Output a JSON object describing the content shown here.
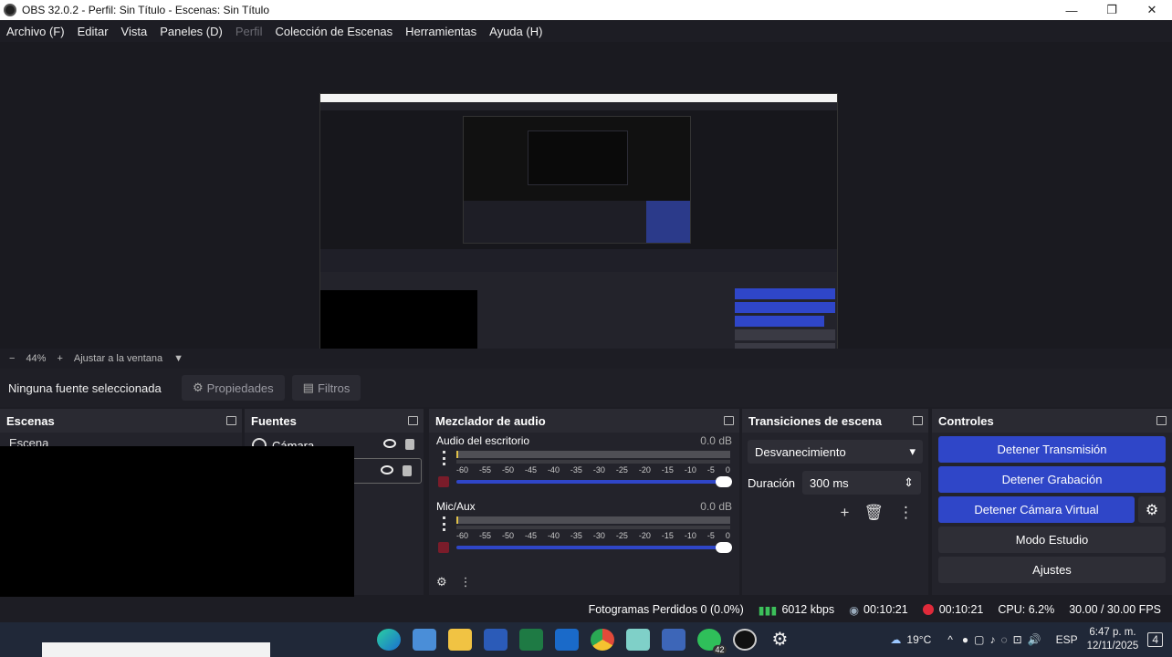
{
  "window": {
    "title": "OBS 32.0.2 - Perfil: Sin Título - Escenas: Sin Título",
    "controls": [
      "—",
      "❐",
      "✕"
    ]
  },
  "menu": [
    "Archivo (F)",
    "Editar",
    "Vista",
    "Paneles (D)",
    "Perfil",
    "Colección de Escenas",
    "Herramientas",
    "Ayuda (H)"
  ],
  "zoom": {
    "minus": "−",
    "level": "44%",
    "plus": "+",
    "fit": "Ajustar a la ventana",
    "caret": "▼"
  },
  "source_toolbar": {
    "no_selection": "Ninguna fuente seleccionada",
    "properties": "Propiedades",
    "filters": "Filtros"
  },
  "scenes": {
    "title": "Escenas",
    "items": [
      "Escena"
    ]
  },
  "sources": {
    "title": "Fuentes",
    "items": [
      "Cámara"
    ]
  },
  "mixer": {
    "title": "Mezclador de audio",
    "channels": [
      {
        "name": "Audio del escritorio",
        "db": "0.0 dB"
      },
      {
        "name": "Mic/Aux",
        "db": "0.0 dB"
      }
    ],
    "scale": [
      "-60",
      "-55",
      "-50",
      "-45",
      "-40",
      "-35",
      "-30",
      "-25",
      "-20",
      "-15",
      "-10",
      "-5",
      "0"
    ]
  },
  "transitions": {
    "title": "Transiciones de escena",
    "selected": "Desvanecimiento",
    "duration_label": "Duración",
    "duration_value": "300 ms"
  },
  "controls": {
    "title": "Controles",
    "stop_stream": "Detener Transmisión",
    "stop_record": "Detener Grabación",
    "stop_vcam": "Detener Cámara Virtual",
    "studio": "Modo Estudio",
    "settings": "Ajustes"
  },
  "status": {
    "dropped": "Fotogramas Perdidos 0 (0.0%)",
    "bitrate": "6012 kbps",
    "stream_time": "00:10:21",
    "record_time": "00:10:21",
    "cpu": "CPU: 6.2%",
    "fps": "30.00 / 30.00 FPS"
  },
  "taskbar": {
    "temperature": "19°C",
    "lang": "ESP",
    "time": "6:47 p. m.",
    "date": "12/11/2025",
    "badge": "42",
    "notif": "4"
  },
  "colors": {
    "accent": "#2f46c8",
    "background": "#1d1d24",
    "dock": "#23232b",
    "live": "#e02a3a"
  }
}
